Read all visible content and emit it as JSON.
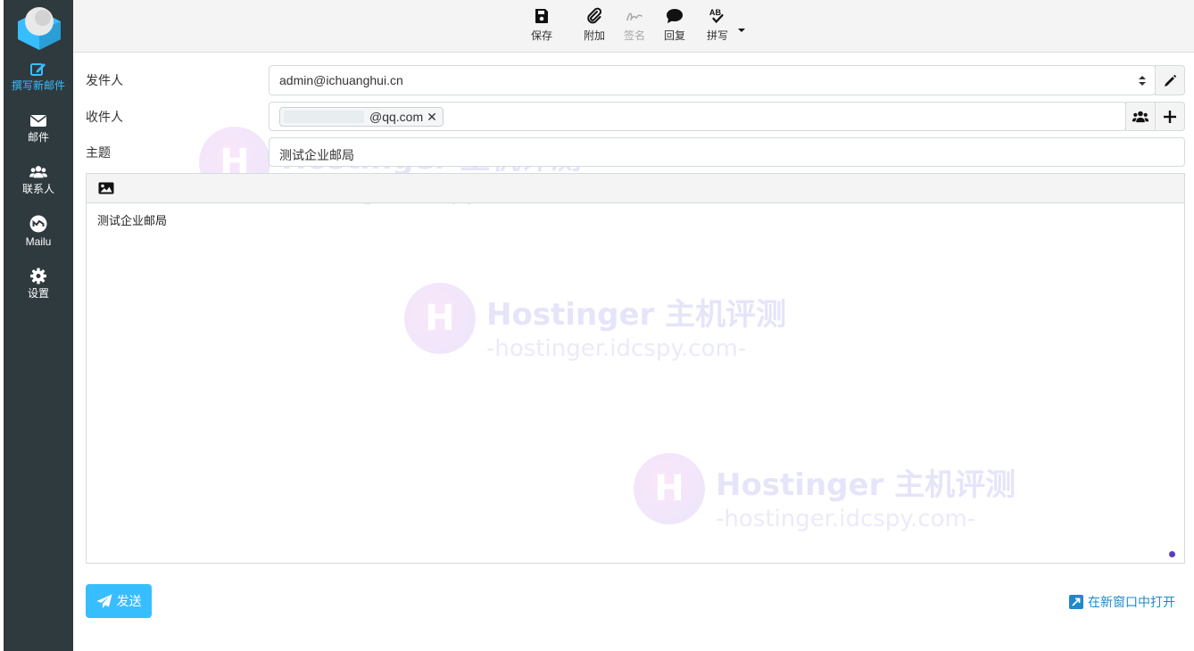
{
  "nav": {
    "items": [
      {
        "label": "撰写新邮件",
        "icon": "compose-icon",
        "active": true
      },
      {
        "label": "邮件",
        "icon": "envelope-icon"
      },
      {
        "label": "联系人",
        "icon": "contacts-icon"
      },
      {
        "label": "Mailu",
        "icon": "mailu-icon"
      },
      {
        "label": "设置",
        "icon": "gear-icon"
      }
    ]
  },
  "toolbar": {
    "save": "保存",
    "attach": "附加",
    "signature": "签名",
    "reply": "回复",
    "spell": "拼写"
  },
  "form": {
    "from_label": "发件人",
    "from_value": "admin@ichuanghui.cn",
    "to_label": "收件人",
    "to_recipient": "@qq.com",
    "subject_label": "主题",
    "subject_value": "测试企业邮局"
  },
  "editor": {
    "body": "测试企业邮局"
  },
  "footer": {
    "send": "发送",
    "open_new_window": "在新窗口中打开"
  },
  "watermark": {
    "line1": "Hostinger 主机评测",
    "line2": "-hostinger.idcspy.com-",
    "badge": "H"
  },
  "colors": {
    "sidebar_bg": "#2f3a3f",
    "accent": "#37beff",
    "link": "#1f8ac9"
  }
}
